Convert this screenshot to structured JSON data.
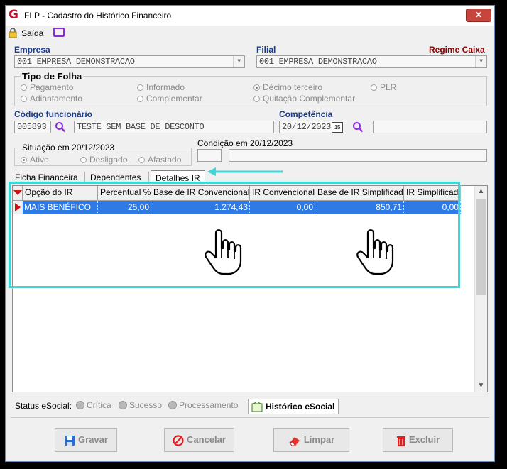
{
  "window": {
    "title": "FLP - Cadastro do Histórico Financeiro",
    "close": "✕"
  },
  "menu": {
    "saida": "Saída"
  },
  "empresa": {
    "label": "Empresa",
    "value": "001 EMPRESA DEMONSTRACAO"
  },
  "filial": {
    "label": "Filial",
    "value": "001 EMPRESA DEMONSTRACAO"
  },
  "regime": {
    "label": "Regime Caixa"
  },
  "tipo_folha": {
    "title": "Tipo de Folha",
    "options": [
      "Pagamento",
      "Informado",
      "Décimo terceiro",
      "PLR",
      "Adiantamento",
      "Complementar",
      "Quitação Complementar"
    ],
    "selected": "Décimo terceiro"
  },
  "funcionario": {
    "label": "Código funcionário",
    "code": "005893",
    "name": "TESTE SEM BASE DE DESCONTO"
  },
  "competencia": {
    "label": "Competência",
    "date": "20/12/2023",
    "calendar_icon": "15"
  },
  "situacao": {
    "title": "Situação em 20/12/2023",
    "options": [
      "Ativo",
      "Desligado",
      "Afastado"
    ],
    "selected": "Ativo"
  },
  "condicao": {
    "title": "Condição em 20/12/2023"
  },
  "tabs": [
    "Ficha Financeira",
    "Dependentes",
    "Detalhes IR"
  ],
  "active_tab": "Detalhes IR",
  "grid": {
    "columns": [
      "Opção do IR",
      "Percentual %",
      "Base de IR Convencional",
      "IR Convencional",
      "Base de IR Simplificado",
      "IR Simplificado"
    ],
    "rows": [
      {
        "opcao": "MAIS BENÉFICO",
        "percentual": "25,00",
        "base_conv": "1.274,43",
        "ir_conv": "0,00",
        "base_simp": "850,71",
        "ir_simp": "0,00"
      }
    ]
  },
  "status": {
    "label": "Status eSocial:",
    "items": [
      "Crítica",
      "Sucesso",
      "Processamento"
    ],
    "history_button": "Histórico eSocial"
  },
  "buttons": {
    "gravar": "Gravar",
    "cancelar": "Cancelar",
    "limpar": "Limpar",
    "excluir": "Excluir"
  },
  "colors": {
    "accent_blue": "#2e7be6",
    "highlight": "#3fd6d6",
    "label_blue": "#1a3b8a",
    "regime_red": "#8b0000"
  }
}
